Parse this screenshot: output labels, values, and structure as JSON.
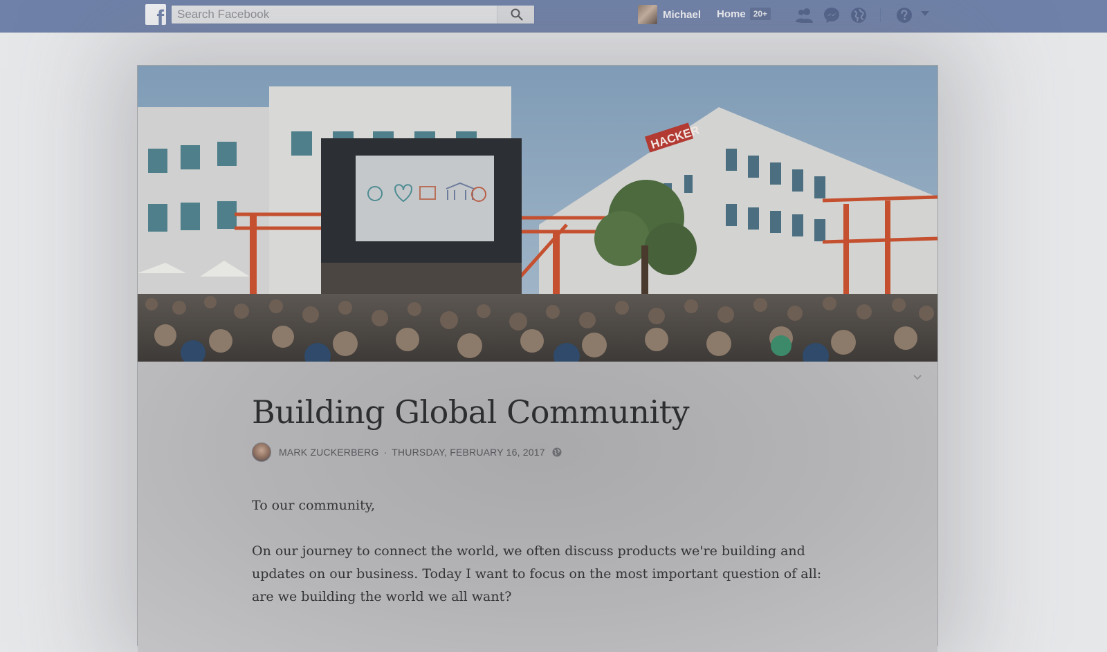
{
  "topbar": {
    "logo_letter": "f",
    "search_placeholder": "Search Facebook",
    "profile_name": "Michael",
    "home_label": "Home",
    "home_badge": "20+"
  },
  "icons": {
    "search": "search-icon",
    "friends": "friend-requests-icon",
    "messages": "messenger-icon",
    "notifications": "globe-notifications-icon",
    "help": "question-icon",
    "menu": "caret-down-icon",
    "post_options": "chevron-down-icon",
    "privacy": "globe-privacy-icon"
  },
  "colors": {
    "topbar": "#6f81a9",
    "page_bg": "#e6e7e9"
  },
  "article": {
    "title": "Building Global Community",
    "author": "MARK ZUCKERBERG",
    "separator": "·",
    "date": "THURSDAY, FEBRUARY 16, 2017",
    "paragraphs": [
      "To our community,",
      "On our journey to connect the world, we often discuss products we're building and updates on our business. Today I want to focus on the most important question of all: are we building the world we all want?"
    ],
    "banner": {
      "sign_text": "HACKER"
    }
  }
}
